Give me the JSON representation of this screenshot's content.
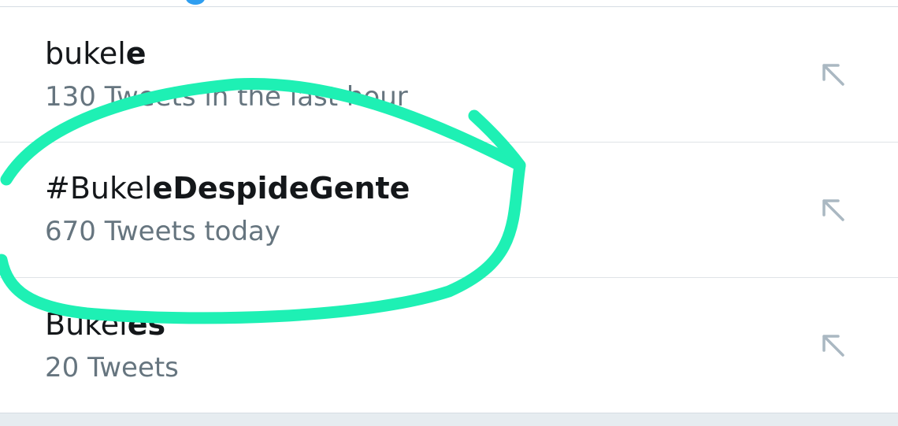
{
  "trends": [
    {
      "name_normal": "bukel",
      "name_bold": "e",
      "meta": "130 Tweets in the last hour"
    },
    {
      "name_normal": "#Bukel",
      "name_bold": "eDespideGente",
      "meta": "670 Tweets today"
    },
    {
      "name_normal": "Bukel",
      "name_bold": "es",
      "meta": "20 Tweets"
    }
  ],
  "colors": {
    "annotation_stroke": "#1ef0b4",
    "title_text": "#14171a",
    "meta_text": "#66757f",
    "arrow_icon": "#aab8c2",
    "accent_blue": "#2f9ef0"
  },
  "icons": {
    "row_action": "arrow-up-left-icon"
  }
}
